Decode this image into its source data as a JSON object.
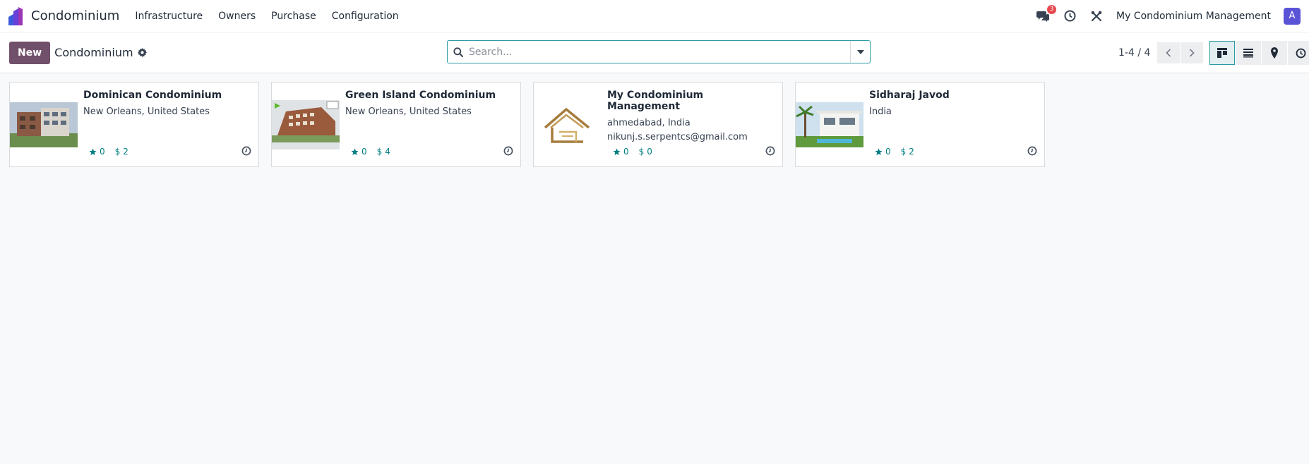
{
  "navbar": {
    "app_name": "Condominium",
    "menu": [
      "Infrastructure",
      "Owners",
      "Purchase",
      "Configuration"
    ],
    "messages_count": "3",
    "company": "My Condominium Management",
    "avatar_initial": "A"
  },
  "control_panel": {
    "new_label": "New",
    "breadcrumb": "Condominium",
    "search_placeholder": "Search...",
    "pager": "1-4 / 4"
  },
  "cards": [
    {
      "title": "Dominican Condominium",
      "lines": [
        "New Orleans, United States"
      ],
      "rating": "0",
      "amount": "2"
    },
    {
      "title": "Green Island Condominium",
      "lines": [
        "New Orleans, United States"
      ],
      "rating": "0",
      "amount": "4"
    },
    {
      "title": "My Condominium Management",
      "lines": [
        "ahmedabad, India",
        "nikunj.s.serpentcs@gmail.com"
      ],
      "rating": "0",
      "amount": "0"
    },
    {
      "title": "Sidharaj Javod",
      "lines": [
        "India"
      ],
      "rating": "0",
      "amount": "2"
    }
  ],
  "colors": {
    "primary": "#71506b",
    "accent": "#017e84",
    "badge": "#e5484d",
    "avatar": "#5b53d6"
  }
}
